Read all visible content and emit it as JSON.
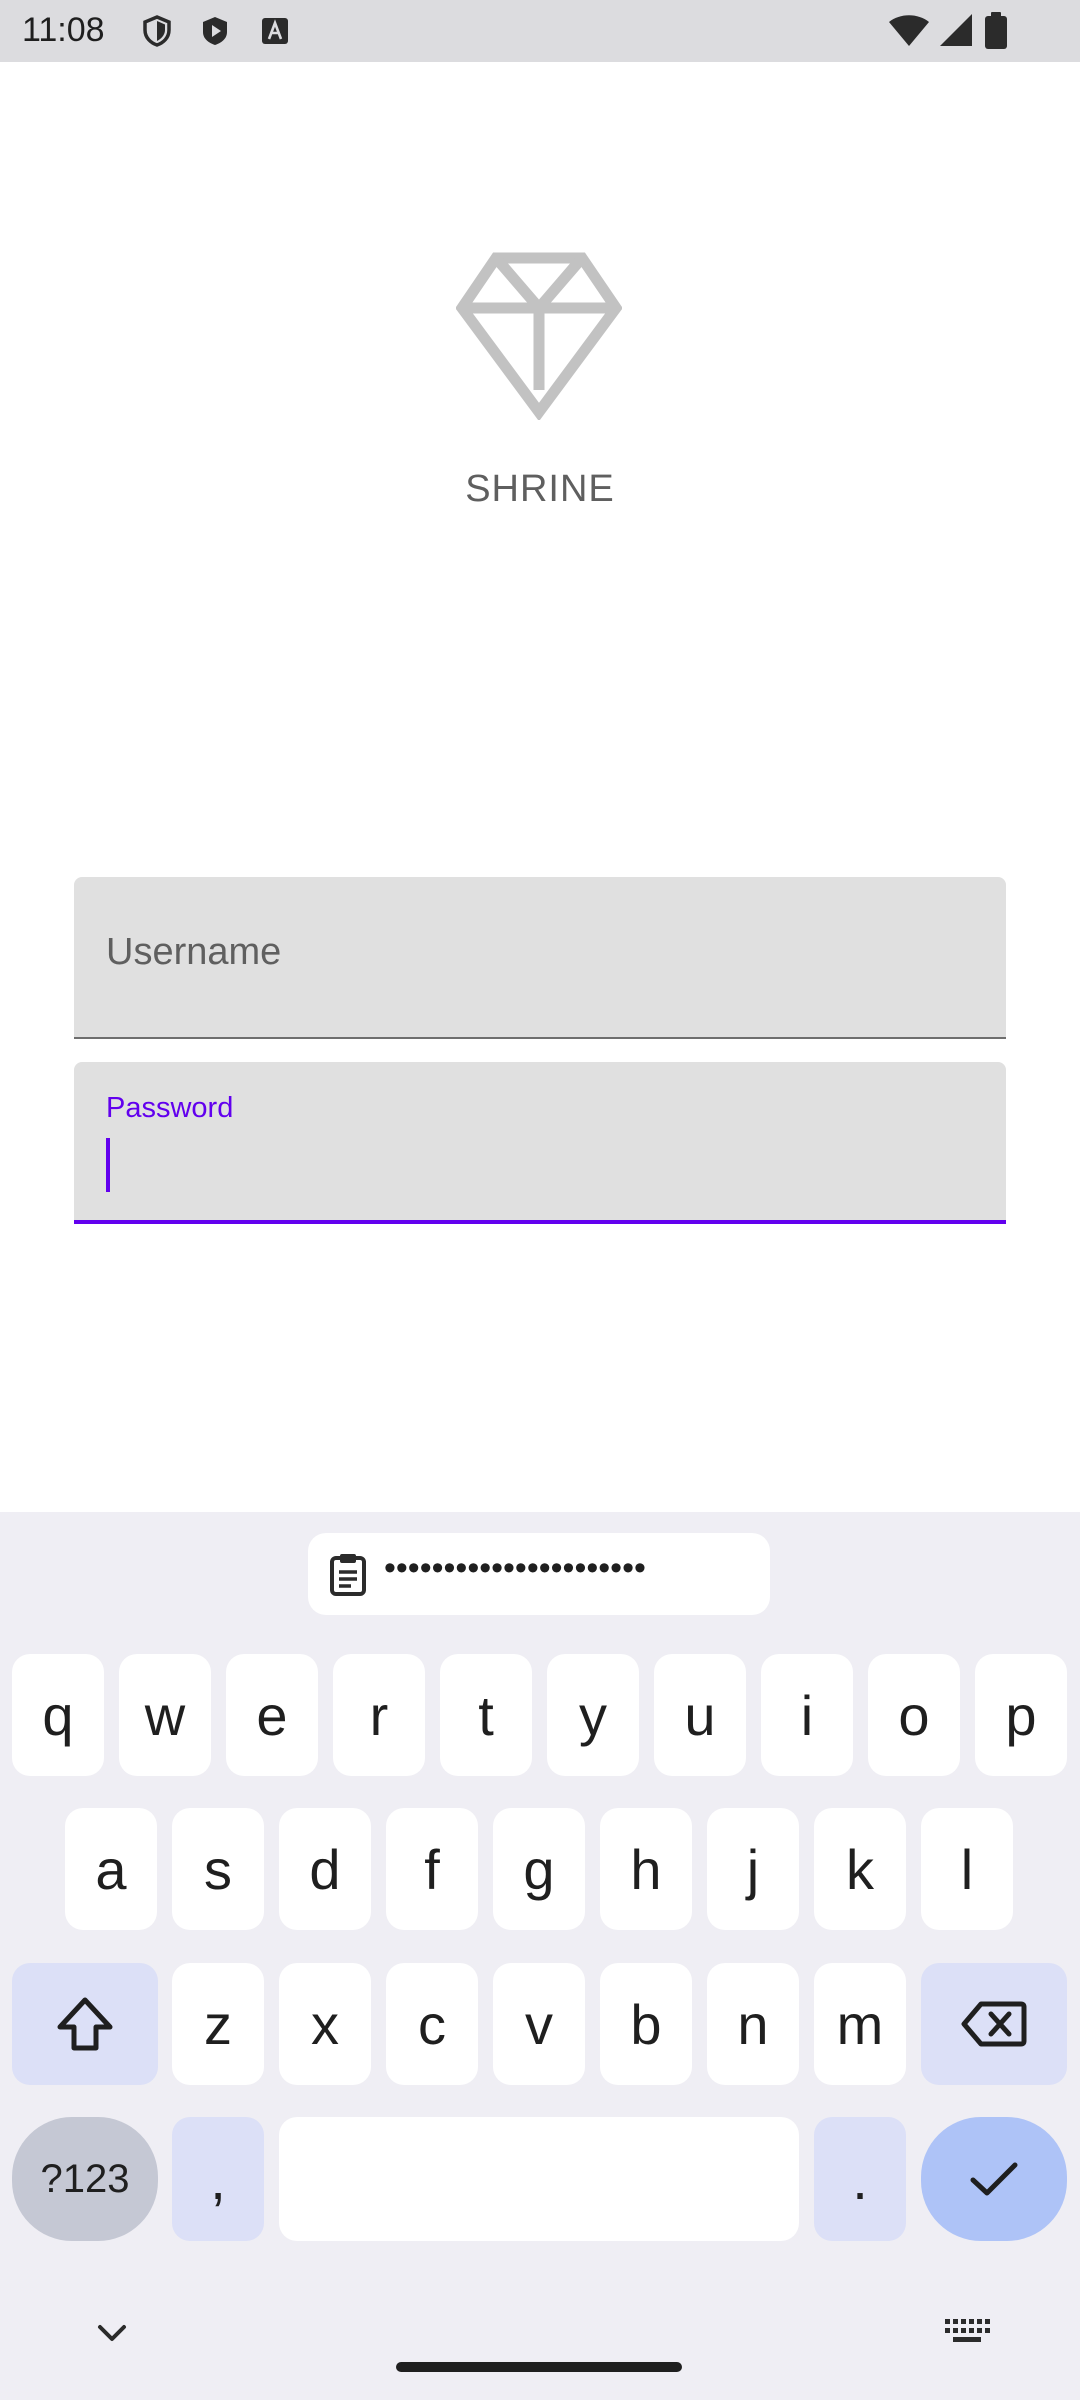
{
  "status_bar": {
    "time": "11:08",
    "icons_left": [
      "shield-icon",
      "play-icon",
      "font-icon"
    ],
    "icons_right": [
      "wifi-icon",
      "signal-icon",
      "battery-icon"
    ]
  },
  "app": {
    "logo_icon": "diamond-icon",
    "title": "SHRINE"
  },
  "form": {
    "username_label": "Username",
    "password_label": "Password"
  },
  "keyboard": {
    "clipboard_text": "••••••••••••••••••••••",
    "row1": [
      "q",
      "w",
      "e",
      "r",
      "t",
      "y",
      "u",
      "i",
      "o",
      "p"
    ],
    "row2": [
      "a",
      "s",
      "d",
      "f",
      "g",
      "h",
      "j",
      "k",
      "l"
    ],
    "row3": [
      "z",
      "x",
      "c",
      "v",
      "b",
      "n",
      "m"
    ],
    "symbols_label": "?123",
    "comma_label": ",",
    "period_label": ".",
    "shift_icon": "shift-icon",
    "backspace_icon": "backspace-icon",
    "enter_icon": "check-icon"
  },
  "colors": {
    "accent": "#6200ee",
    "field_bg": "#e0e0e0",
    "keyboard_bg": "#efeef4",
    "mod_key": "#dce0f7",
    "enter_key": "#aec3f7"
  }
}
